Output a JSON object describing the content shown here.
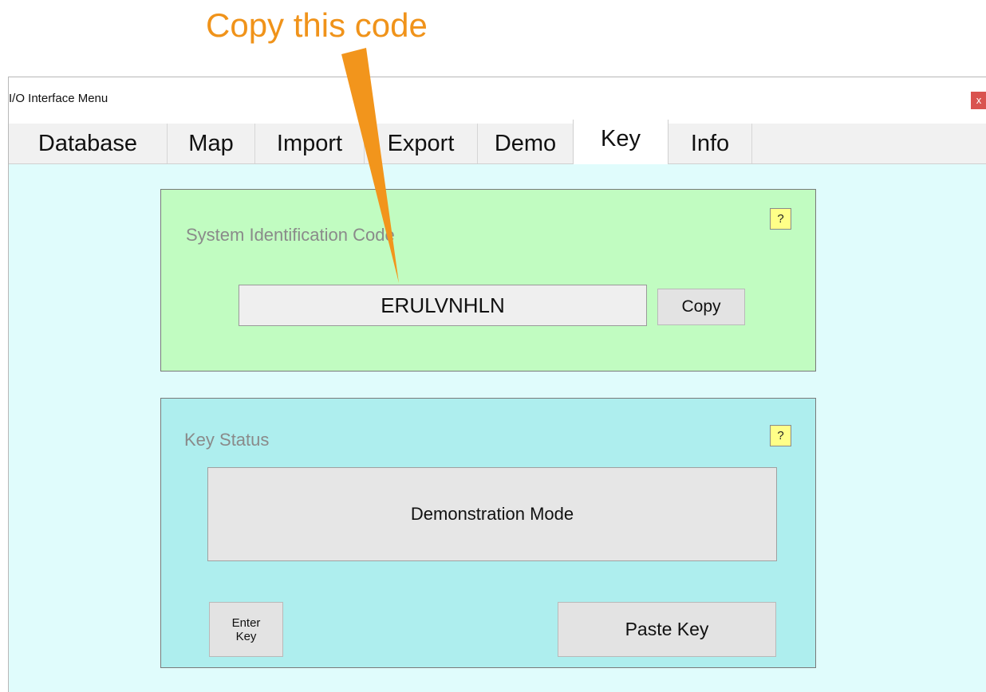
{
  "annotation": {
    "text": "Copy this code",
    "color": "#f0931a"
  },
  "window": {
    "title": "I/O Interface Menu",
    "close_label": "x"
  },
  "tabs": [
    {
      "label": "Database"
    },
    {
      "label": "Map"
    },
    {
      "label": "Import"
    },
    {
      "label": "Export"
    },
    {
      "label": "Demo"
    },
    {
      "label": "Key",
      "active": true
    },
    {
      "label": "Info"
    }
  ],
  "system_id": {
    "label": "System Identification Code",
    "help": "?",
    "code": "ERULVNHLN",
    "copy_label": "Copy"
  },
  "key_status": {
    "label": "Key Status",
    "help": "?",
    "status": "Demonstration Mode",
    "enter_key_line1": "Enter",
    "enter_key_line2": "Key",
    "paste_key_label": "Paste Key"
  }
}
